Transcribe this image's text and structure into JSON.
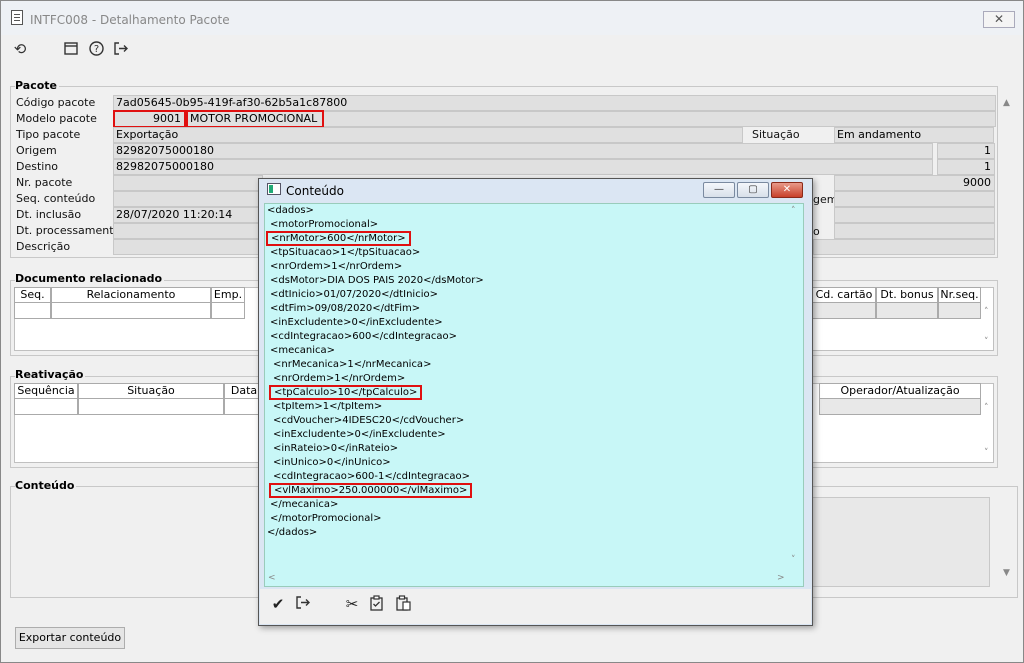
{
  "window": {
    "title": "INTFC008 - Detalhamento Pacote",
    "close_glyph": "✕"
  },
  "toolbar": {
    "refresh_icon": "refresh-icon",
    "calendar_icon": "calendar-icon",
    "help_icon": "help-icon",
    "exit_icon": "exit-icon"
  },
  "pacote": {
    "group_label": "Pacote",
    "codigo_label": "Código pacote",
    "codigo_value": "7ad05645-0b95-419f-af30-62b5a1c87800",
    "modelo_label": "Modelo pacote",
    "modelo_code": "9001",
    "modelo_name": "MOTOR PROMOCIONAL",
    "tipo_label": "Tipo pacote",
    "tipo_value": "Exportação",
    "situacao_label": "Situação",
    "situacao_value": "Em andamento",
    "origem_label": "Origem",
    "origem_value": "82982075000180",
    "origem_num": "1",
    "destino_label": "Destino",
    "destino_value": "82982075000180",
    "destino_num": "1",
    "nr_label": "Nr. pacote",
    "nr_value": "9000",
    "seq_label": "Seq. conteúdo",
    "seq_right_label": "gem",
    "inclusao_label": "Dt. inclusão",
    "inclusao_value": "28/07/2020 11:20:14",
    "processamento_label": "Dt. processamento",
    "processamento_right_label": "o",
    "descricao_label": "Descrição"
  },
  "documento": {
    "group_label": "Documento relacionado",
    "columns_left": [
      "Seq.",
      "Relacionamento",
      "Emp."
    ],
    "columns_right": [
      "Cd. cartão",
      "Dt. bonus",
      "Nr.seq."
    ]
  },
  "reativacao": {
    "group_label": "Reativação",
    "columns_left": [
      "Sequência",
      "Situação",
      "Data"
    ],
    "columns_right": [
      "Operador/Atualização"
    ]
  },
  "conteudo": {
    "group_label": "Conteúdo",
    "export_button": "Exportar conteúdo"
  },
  "dialog": {
    "title": "Conteúdo",
    "lines": [
      "<dados>",
      " <motorPromocional>",
      " <nrMotor>600</nrMotor>",
      " <tpSituacao>1</tpSituacao>",
      " <nrOrdem>1</nrOrdem>",
      " <dsMotor>DIA DOS PAIS 2020</dsMotor>",
      " <dtInicio>01/07/2020</dtInicio>",
      " <dtFim>09/08/2020</dtFim>",
      " <inExcludente>0</inExcludente>",
      " <cdIntegracao>600</cdIntegracao>",
      " <mecanica>",
      "  <nrMecanica>1</nrMecanica>",
      "  <nrOrdem>1</nrOrdem>",
      "  <tpCalculo>10</tpCalculo>",
      "  <tpItem>1</tpItem>",
      "  <cdVoucher>4IDESC20</cdVoucher>",
      "  <inExcludente>0</inExcludente>",
      "  <inRateio>0</inRateio>",
      "  <inUnico>0</inUnico>",
      "  <cdIntegracao>600-1</cdIntegracao>",
      "  <vlMaximo>250.000000</vlMaximo>",
      " </mecanica>",
      " </motorPromocional>",
      "</dados>"
    ],
    "highlighted_lines": [
      2,
      13,
      20
    ],
    "bottom_icons": [
      "check-icon",
      "exit-icon",
      "cut-icon",
      "copy-icon",
      "paste-icon"
    ]
  },
  "colors": {
    "highlight": "#e01010",
    "xml_bg": "#c8f7f7",
    "field_bg": "#e0e0e0"
  }
}
